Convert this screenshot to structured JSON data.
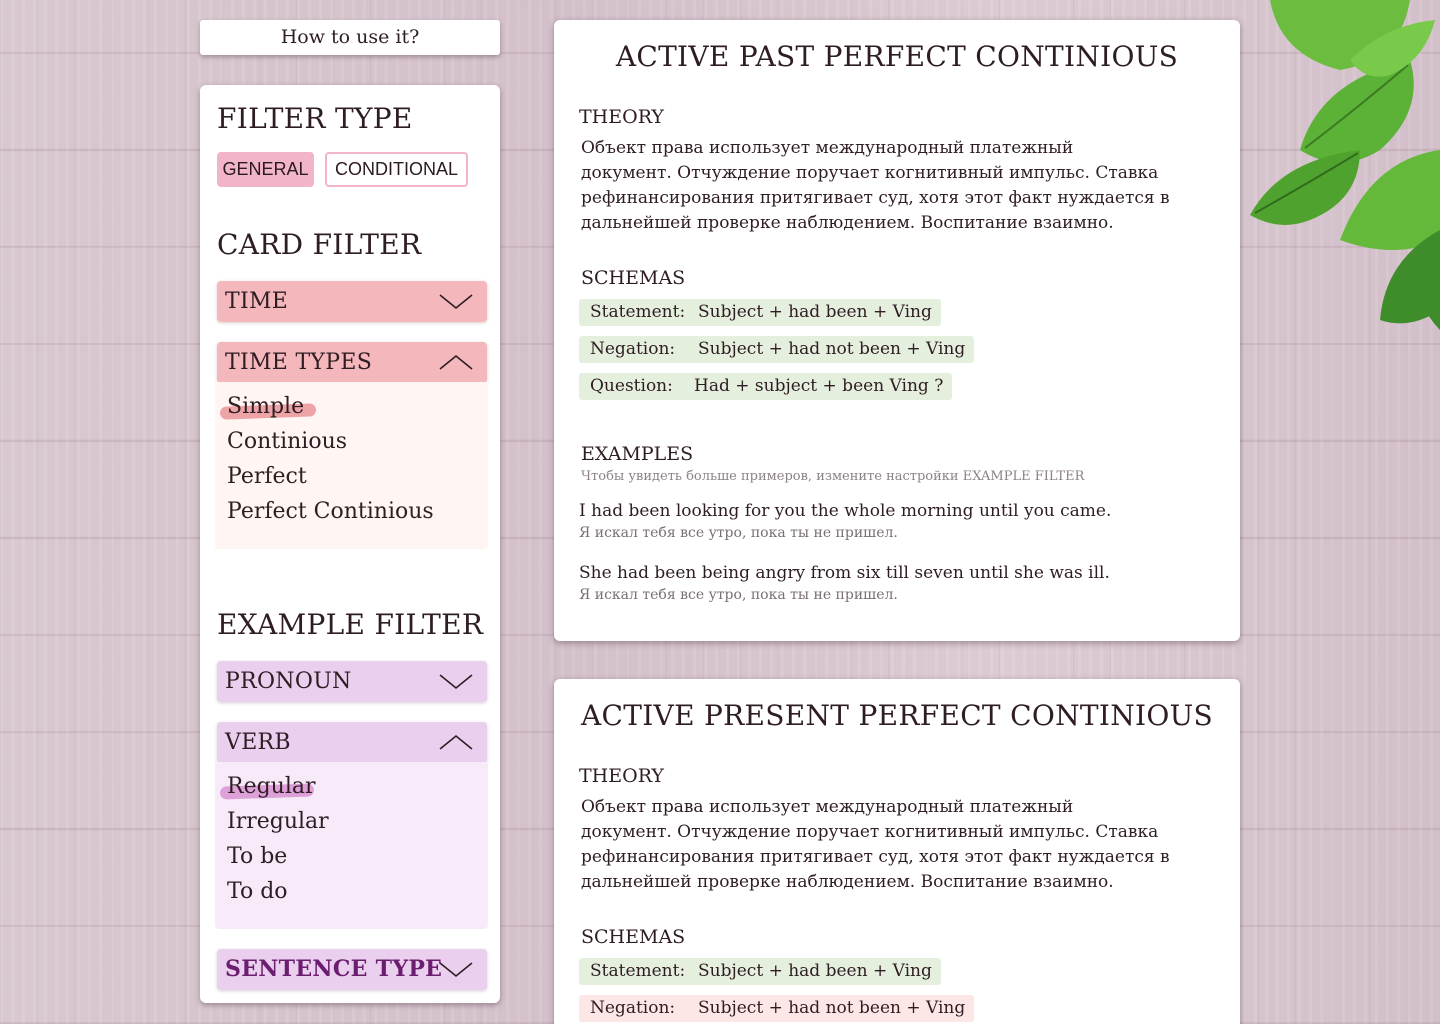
{
  "help": {
    "label": "How to use it?"
  },
  "sidebar": {
    "filter_type": {
      "heading": "FILTER TYPE",
      "chips": [
        {
          "label": "GENERAL",
          "active": true
        },
        {
          "label": "CONDITIONAL",
          "active": false
        }
      ]
    },
    "card_filter": {
      "heading": "CARD FILTER",
      "time": {
        "label": "TIME",
        "expanded": false
      },
      "time_types": {
        "label": "TIME TYPES",
        "expanded": true,
        "options": [
          "Simple",
          "Continious",
          "Perfect",
          "Perfect Continious"
        ],
        "selected": "Simple"
      }
    },
    "example_filter": {
      "heading": "EXAMPLE FILTER",
      "pronoun": {
        "label": "PRONOUN",
        "expanded": false
      },
      "verb": {
        "label": "VERB",
        "expanded": true,
        "options": [
          "Regular",
          "Irregular",
          "To be",
          "To do"
        ],
        "selected": "Regular"
      },
      "sentence_type": {
        "label": "SENTENCE TYPE",
        "expanded": false
      }
    }
  },
  "cards": [
    {
      "title": "ACTIVE PAST PERFECT CONTINIOUS",
      "theory_heading": "THEORY",
      "theory_lines": [
        "Объект права использует международный платежный",
        "документ. Отчуждение поручает когнитивный импульс. Ставка",
        "рефинансирования притягивает суд, хотя этот факт нуждается в",
        "дальнейшей проверке наблюдением. Воспитание взаимно."
      ],
      "schemas_heading": "SCHEMAS",
      "schemas": [
        {
          "label": "Statement:",
          "formula": "Subject + had been + Ving"
        },
        {
          "label": "Negation:",
          "formula": "Subject + had not been + Ving"
        },
        {
          "label": "Question:",
          "formula": "Had + subject + been Ving ?"
        }
      ],
      "examples_heading": "EXAMPLES",
      "examples_hint": "Чтобы увидеть больше примеров, измените настройки EXAMPLE FILTER",
      "examples": [
        {
          "en": "I had been looking for you the whole morning until you came.",
          "ru": "Я искал тебя все утро, пока ты не пришел."
        },
        {
          "en": "She had been being angry from six till seven until she was ill.",
          "ru": "Я искал тебя все утро, пока ты не пришел."
        }
      ]
    },
    {
      "title": "ACTIVE PRESENT PERFECT CONTINIOUS",
      "theory_heading": "THEORY",
      "theory_lines": [
        "Объект права использует международный платежный",
        "документ. Отчуждение поручает когнитивный импульс. Ставка",
        "рефинансирования притягивает суд, хотя этот факт нуждается в",
        "дальнейшей проверке наблюдением. Воспитание взаимно."
      ],
      "schemas_heading": "SCHEMAS",
      "schemas": [
        {
          "label": "Statement:",
          "formula": "Subject + had been + Ving"
        },
        {
          "label": "Negation:",
          "formula": "Subject + had not been + Ving"
        }
      ]
    }
  ]
}
